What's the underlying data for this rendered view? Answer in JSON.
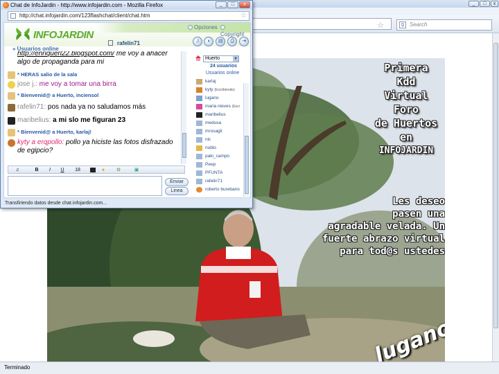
{
  "browser": {
    "search_placeholder": "Search",
    "status": "Terminado"
  },
  "photo": {
    "caption_lines": [
      "Primera",
      "Kdd",
      "Virtual",
      "Foro",
      "de Huertos",
      "en",
      "INFOJARDIN"
    ],
    "greeting_lines": [
      "Les deseo",
      "pasen una",
      "agradable velada. Un",
      "fuerte abrazo virtual",
      "para tod@s ustedes"
    ],
    "signature": "lugano"
  },
  "chat_window": {
    "title": "Chat de InfoJardin - http://www.infojardin.com - Mozilla Firefox",
    "url": "http://chat.infojardin.com/123flashchat/client/chat.htm",
    "status": "Transfiriendo datos desde chat.infojardin.com..."
  },
  "chat": {
    "logo_text": "INFOJARDIN",
    "options_label": "Opciones",
    "copyright_label": "Copyright",
    "current_user": "rafelin71",
    "users_online_header": "Usuarios online",
    "room": "Huerto",
    "user_count": "24 usuarios",
    "users_online_label": "Usuarios online",
    "users": [
      {
        "name": "karlaj",
        "status": ""
      },
      {
        "name": "kyty",
        "status": "(Escribiendo)"
      },
      {
        "name": "lugano",
        "status": ""
      },
      {
        "name": "maria nieves",
        "status": "(Escr"
      },
      {
        "name": "maribelius",
        "status": ""
      },
      {
        "name": "medusa",
        "status": ""
      },
      {
        "name": "mrosagil",
        "status": ""
      },
      {
        "name": "nic",
        "status": ""
      },
      {
        "name": "nublo",
        "status": ""
      },
      {
        "name": "paki_campo",
        "status": ""
      },
      {
        "name": "Peep",
        "status": ""
      },
      {
        "name": "PFUNTA",
        "status": ""
      },
      {
        "name": "rafelin71",
        "status": ""
      },
      {
        "name": "roberto burebano",
        "status": ""
      }
    ],
    "messages": {
      "m1_link": "http://enriquerl22.blogspot.com/",
      "m1_text": " me voy a ahacer algo de propaganda para mi",
      "m2_sys": "* HERAS salio de la sala",
      "m3_nick": "jose j.:",
      "m3_text": " me voy a tomar una birra",
      "m4_sys": "* Bienvenid@ a Huerto, inciensol",
      "m5_nick": "rafelin71:",
      "m5_text": " pos nada ya no saludamos más",
      "m6_nick": "maribelius:",
      "m6_text": " a mi slo me figuran 23",
      "m7_sys": "* Bienvenid@ a Huerto, karlaj!",
      "m8_nick": "kyty a erqpollo:",
      "m8_text": " pollo ya hiciste las fotos disfrazado de egipcio?"
    },
    "format_size": "18",
    "send_label": "Enviar",
    "line_label": "Linea"
  },
  "colors": {
    "brand_green": "#5bab2c",
    "link_blue": "#2759a3",
    "pink_nick": "#e0266f",
    "purple_text": "#9c1a8a"
  }
}
